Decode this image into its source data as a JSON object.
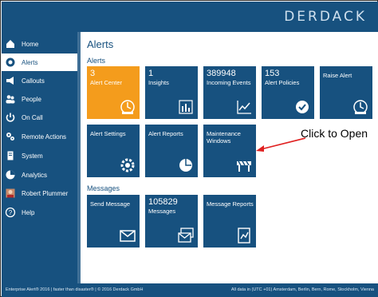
{
  "brand": {
    "logo_text": "DERDACK"
  },
  "sidebar": {
    "items": [
      {
        "label": "Home",
        "icon": "home-icon",
        "active": false
      },
      {
        "label": "Alerts",
        "icon": "alerts-icon",
        "active": true
      },
      {
        "label": "Callouts",
        "icon": "megaphone-icon",
        "active": false
      },
      {
        "label": "People",
        "icon": "people-icon",
        "active": false
      },
      {
        "label": "On Call",
        "icon": "power-icon",
        "active": false
      },
      {
        "label": "Remote Actions",
        "icon": "remote-actions-icon",
        "active": false
      },
      {
        "label": "System",
        "icon": "system-icon",
        "active": false
      },
      {
        "label": "Analytics",
        "icon": "analytics-icon",
        "active": false
      },
      {
        "label": "Robert Plummer",
        "icon": "user-avatar-icon",
        "active": false
      },
      {
        "label": "Help",
        "icon": "help-icon",
        "active": false
      }
    ]
  },
  "main": {
    "title": "Alerts",
    "sections": {
      "alerts": "Alerts",
      "messages": "Messages"
    },
    "tiles": {
      "alert_center": {
        "number": "3",
        "label": "Alert Center",
        "icon": "alert-bell-icon"
      },
      "insights": {
        "number": "1",
        "label": "Insights",
        "icon": "insights-icon"
      },
      "incoming_events": {
        "number": "389948",
        "label": "Incoming Events",
        "icon": "line-chart-icon"
      },
      "alert_policies": {
        "number": "153",
        "label": "Alert Policies",
        "icon": "policy-icon"
      },
      "raise_alert": {
        "label": "Raise Alert",
        "icon": "raise-alert-icon"
      },
      "alert_settings": {
        "label": "Alert Settings",
        "icon": "settings-icon"
      },
      "alert_reports": {
        "label": "Alert Reports",
        "icon": "report-globe-icon"
      },
      "maintenance_windows": {
        "label": "Maintenance Windows",
        "icon": "barrier-icon"
      },
      "send_message": {
        "label": "Send Message",
        "icon": "envelope-icon"
      },
      "messages": {
        "number": "105829",
        "label": "Messages",
        "icon": "envelopes-icon"
      },
      "message_reports": {
        "label": "Message Reports",
        "icon": "report-chart-icon"
      }
    }
  },
  "annotation": {
    "text": "Click to Open"
  },
  "footer": {
    "left": "Enterprise Alert® 2016 | faster than disaster® | © 2016 Derdack GmbH",
    "right": "All data in (UTC +01) Amsterdam, Berlin, Bern, Rome, Stockholm, Vienna"
  },
  "colors": {
    "primary": "#17517f",
    "accent": "#f49c1c",
    "annotation_arrow": "#e02020"
  }
}
